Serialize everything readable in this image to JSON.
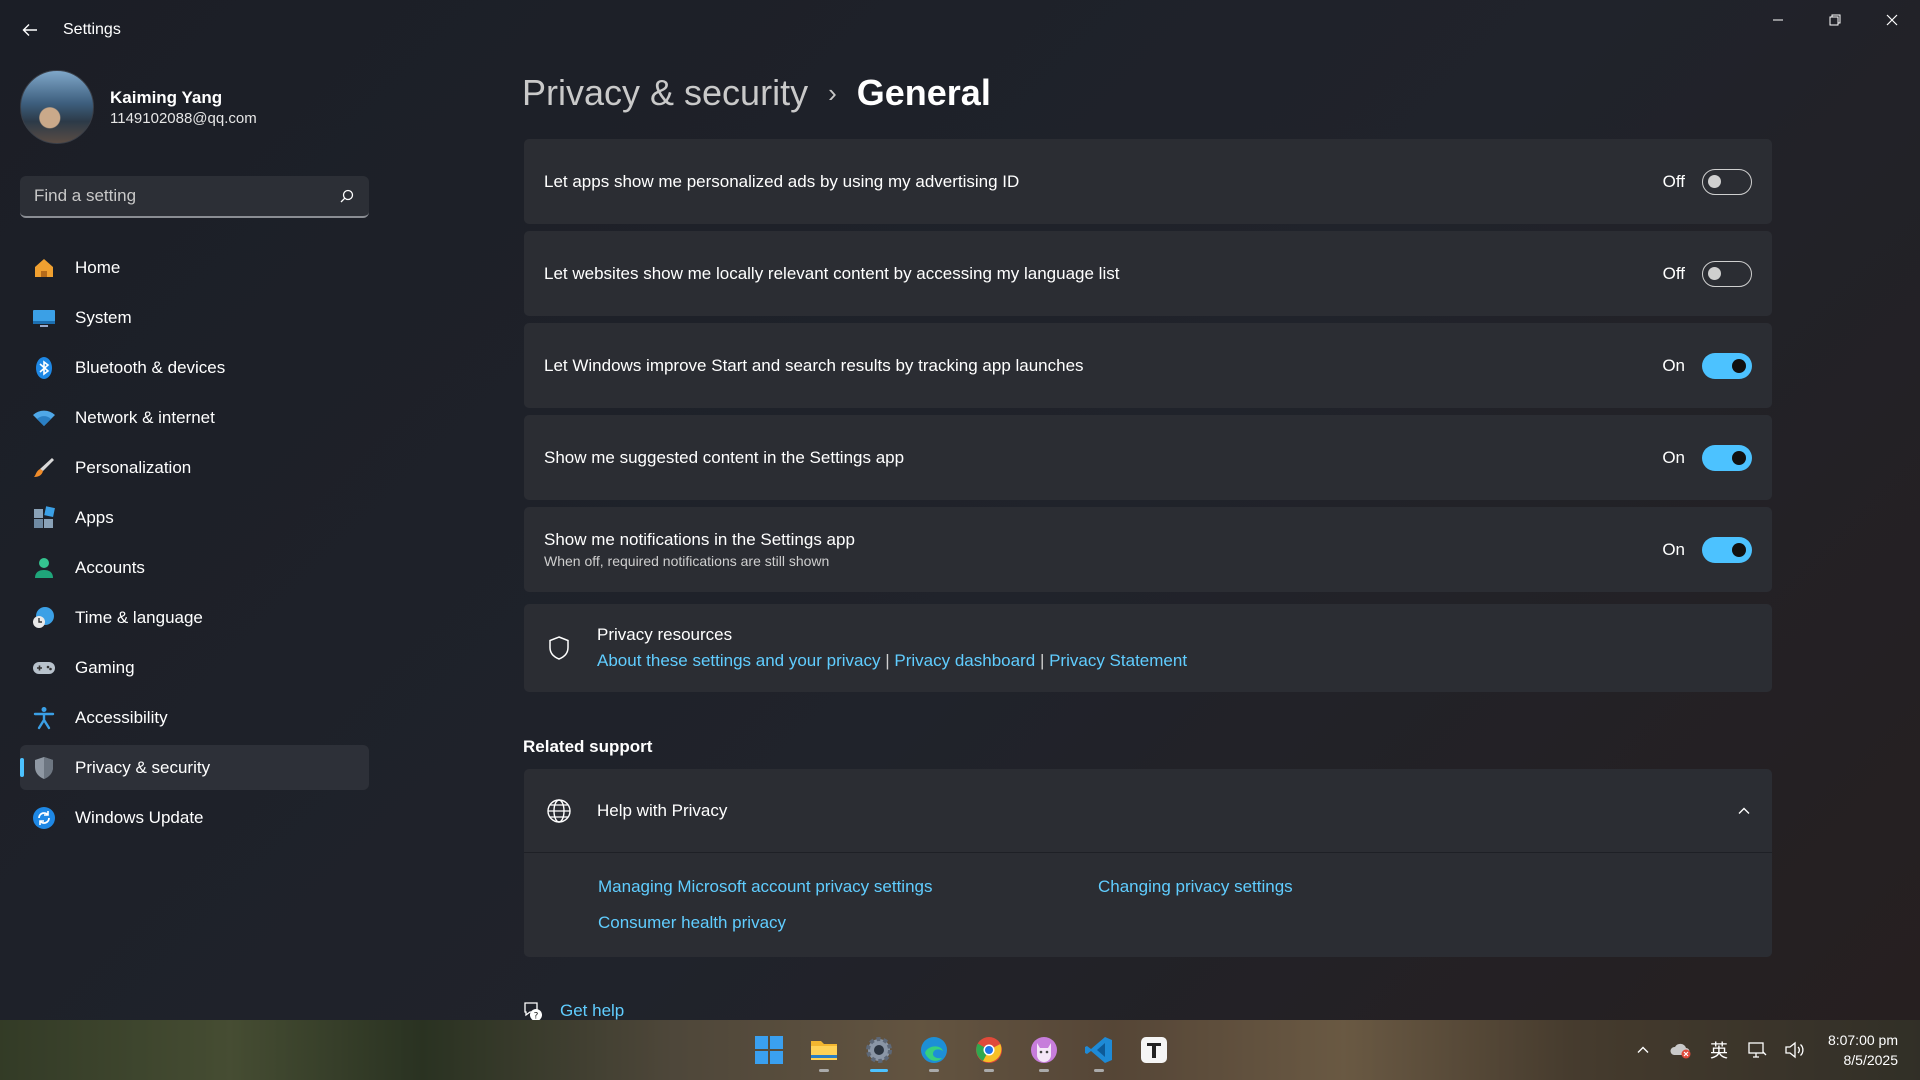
{
  "window": {
    "title": "Settings"
  },
  "profile": {
    "name": "Kaiming Yang",
    "email": "1149102088@qq.com"
  },
  "search": {
    "placeholder": "Find a setting"
  },
  "nav": {
    "items": [
      {
        "label": "Home",
        "icon": "home-icon"
      },
      {
        "label": "System",
        "icon": "system-icon"
      },
      {
        "label": "Bluetooth & devices",
        "icon": "bluetooth-icon"
      },
      {
        "label": "Network & internet",
        "icon": "wifi-icon"
      },
      {
        "label": "Personalization",
        "icon": "brush-icon"
      },
      {
        "label": "Apps",
        "icon": "apps-icon"
      },
      {
        "label": "Accounts",
        "icon": "accounts-icon"
      },
      {
        "label": "Time & language",
        "icon": "time-language-icon"
      },
      {
        "label": "Gaming",
        "icon": "gamepad-icon"
      },
      {
        "label": "Accessibility",
        "icon": "accessibility-icon"
      },
      {
        "label": "Privacy & security",
        "icon": "shield-icon",
        "active": true
      },
      {
        "label": "Windows Update",
        "icon": "update-icon"
      }
    ]
  },
  "breadcrumb": {
    "parent": "Privacy & security",
    "separator": "›",
    "current": "General"
  },
  "settings": [
    {
      "label": "Let apps show me personalized ads by using my advertising ID",
      "state": "Off",
      "on": false
    },
    {
      "label": "Let websites show me locally relevant content by accessing my language list",
      "state": "Off",
      "on": false
    },
    {
      "label": "Let Windows improve Start and search results by tracking app launches",
      "state": "On",
      "on": true
    },
    {
      "label": "Show me suggested content in the Settings app",
      "state": "On",
      "on": true
    },
    {
      "label": "Show me notifications in the Settings app",
      "description": "When off, required notifications are still shown",
      "state": "On",
      "on": true
    }
  ],
  "resources": {
    "title": "Privacy resources",
    "links": [
      "About these settings and your privacy",
      "Privacy dashboard",
      "Privacy Statement"
    ],
    "separator": "|"
  },
  "related": {
    "title": "Related support",
    "help_title": "Help with Privacy",
    "links": [
      "Managing Microsoft account privacy settings",
      "Changing privacy settings",
      "Consumer health privacy"
    ]
  },
  "get_help": {
    "label": "Get help"
  },
  "taskbar": {
    "apps": [
      "start-icon",
      "file-explorer-icon",
      "settings-icon",
      "edge-icon",
      "chrome-icon",
      "cat-app-icon",
      "vscode-icon",
      "typora-icon"
    ],
    "tray": {
      "ime": "英",
      "time": "8:07:00 pm",
      "date": "8/5/2025"
    }
  },
  "colors": {
    "accent": "#4cc2ff",
    "link": "#60cdff",
    "card": "#2b2d33"
  }
}
